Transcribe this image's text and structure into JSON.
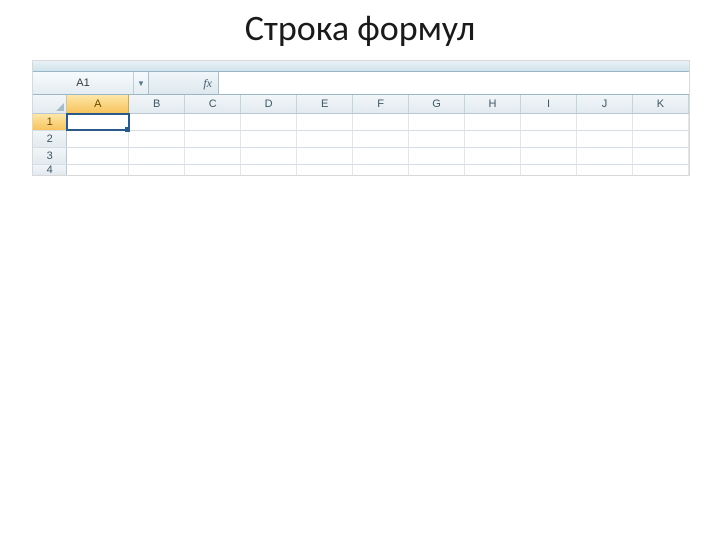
{
  "title": "Строка формул",
  "formula_bar": {
    "name_box_value": "A1",
    "fx_label": "fx",
    "formula_value": ""
  },
  "columns": [
    "A",
    "B",
    "C",
    "D",
    "E",
    "F",
    "G",
    "H",
    "I",
    "J",
    "K"
  ],
  "active_column_index": 0,
  "rows": [
    "1",
    "2",
    "3",
    "4"
  ],
  "active_row_index": 0,
  "selected_cell": {
    "row": 0,
    "col": 0
  }
}
